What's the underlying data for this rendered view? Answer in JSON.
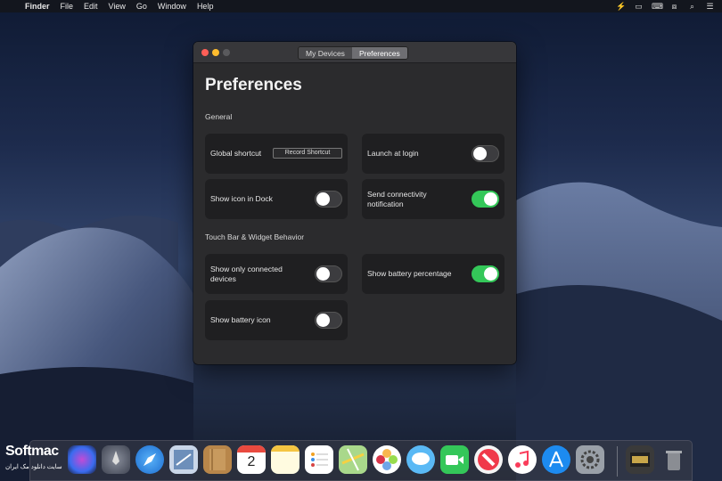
{
  "menubar": {
    "app_name": "Finder",
    "items": [
      "File",
      "Edit",
      "View",
      "Go",
      "Window",
      "Help"
    ],
    "status_icons": [
      "bolt-icon",
      "display-icon",
      "keyboard-icon",
      "airplay-icon",
      "search-icon",
      "menu-list-icon"
    ]
  },
  "window": {
    "tabs": [
      "My Devices",
      "Preferences"
    ],
    "active_tab": "Preferences",
    "title": "Preferences",
    "sections": {
      "general": "General",
      "touchbar": "Touch Bar & Widget Behavior"
    },
    "cards": {
      "global_shortcut": {
        "label": "Global shortcut",
        "button": "Record Shortcut"
      },
      "launch_login": {
        "label": "Launch at login",
        "on": false
      },
      "show_icon_dock": {
        "label": "Show icon in Dock",
        "on": false
      },
      "send_notification": {
        "label": "Send connectivity notification",
        "on": true
      },
      "show_connected": {
        "label": "Show only connected devices",
        "on": false
      },
      "show_battery_pct": {
        "label": "Show battery percentage",
        "on": true
      },
      "show_battery_icon": {
        "label": "Show battery icon",
        "on": false
      }
    }
  },
  "dock": {
    "apps": [
      "siri-icon",
      "launchpad-icon",
      "safari-icon",
      "mail-stamp-icon",
      "contacts-icon",
      "calendar-icon",
      "notes-icon",
      "reminders-icon",
      "maps-icon",
      "photos-icon",
      "messages-icon",
      "facetime-icon",
      "news-icon",
      "music-icon",
      "app-store-icon",
      "system-preferences-icon"
    ],
    "calendar_day": "2",
    "others": [
      "downloads-stack-icon",
      "trash-icon"
    ]
  },
  "watermark": {
    "brand": "Softmac",
    "tagline": "سایت دانلود مک ایران"
  },
  "colors": {
    "toggle_on": "#34c759",
    "window_bg": "#2b2b2d",
    "card_bg": "#1f1f21"
  }
}
